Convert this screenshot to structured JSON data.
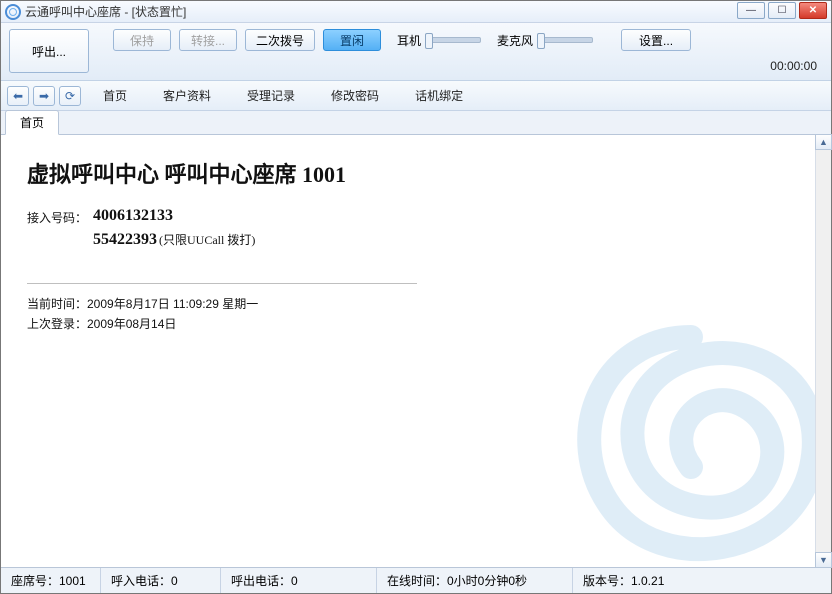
{
  "window": {
    "title": "云通呼叫中心座席 - [状态置忙]"
  },
  "toolbar": {
    "callout": "呼出...",
    "hold": "保持",
    "transfer": "转接...",
    "redial": "二次拨号",
    "idle": "置闲",
    "settings": "设置...",
    "headset_label": "耳机",
    "mic_label": "麦克风",
    "timer": "00:00:00"
  },
  "nav": {
    "home": "首页",
    "customer": "客户资料",
    "records": "受理记录",
    "password": "修改密码",
    "bind": "话机绑定"
  },
  "tab": {
    "active": "首页"
  },
  "page": {
    "headline": "虚拟呼叫中心  呼叫中心座席  1001",
    "access_label": "接入号码：",
    "access_num1": "4006132133",
    "access_num2": "55422393",
    "access_note": "(只限UUCall 拨打)",
    "current_time": "当前时间：2009年8月17日 11:09:29 星期一",
    "last_login": "上次登录：2009年08月14日"
  },
  "status": {
    "seat": "座席号：1001",
    "inbound": "呼入电话：0",
    "outbound": "呼出电话：0",
    "online": "在线时间：0小时0分钟0秒",
    "version": "版本号：1.0.21"
  }
}
